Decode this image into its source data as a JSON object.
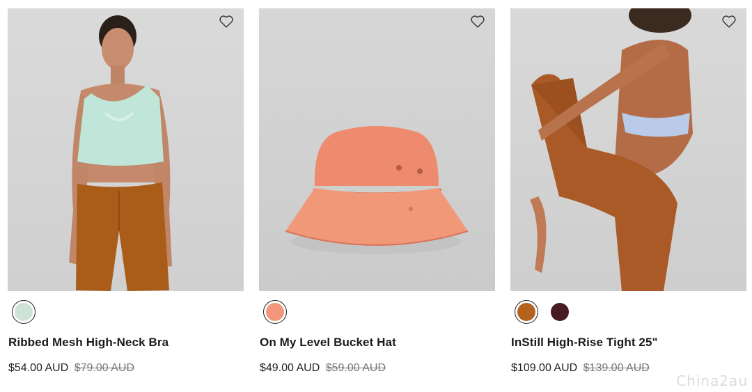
{
  "products": [
    {
      "name": "Ribbed Mesh High-Neck Bra",
      "price": "$54.00 AUD",
      "original_price": "$79.00 AUD",
      "swatches": [
        {
          "color": "#cfe2d8",
          "selected": true
        }
      ]
    },
    {
      "name": "On My Level Bucket Hat",
      "price": "$49.00 AUD",
      "original_price": "$59.00 AUD",
      "swatches": [
        {
          "color": "#f2967c",
          "selected": true
        }
      ]
    },
    {
      "name": "InStill High-Rise Tight 25\"",
      "price": "$109.00 AUD",
      "original_price": "$139.00 AUD",
      "swatches": [
        {
          "color": "#b5621f",
          "selected": true
        },
        {
          "color": "#4a1a22",
          "selected": false
        }
      ]
    }
  ],
  "icons": {
    "wishlist": "heart-outline-icon"
  },
  "watermark": "Chinа2au"
}
